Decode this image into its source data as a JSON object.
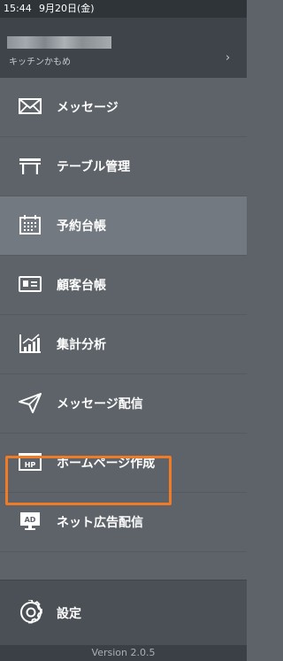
{
  "status_bar": {
    "time": "15:44",
    "date": "9月20日(金)"
  },
  "account": {
    "store_name": "キッチンかもめ",
    "chevron": "›"
  },
  "menu": [
    {
      "label": "メッセージ",
      "icon": "envelope-icon"
    },
    {
      "label": "テーブル管理",
      "icon": "table-icon"
    },
    {
      "label": "予約台帳",
      "icon": "calendar-icon",
      "selected": true
    },
    {
      "label": "顧客台帳",
      "icon": "id-card-icon"
    },
    {
      "label": "集計分析",
      "icon": "bar-chart-icon"
    },
    {
      "label": "メッセージ配信",
      "icon": "paper-plane-icon"
    },
    {
      "label": "ホームページ作成",
      "icon": "homepage-icon",
      "badge": "HP"
    },
    {
      "label": "ネット広告配信",
      "icon": "ad-monitor-icon",
      "badge": "AD"
    }
  ],
  "settings": {
    "label": "設定",
    "icon": "gear-icon"
  },
  "footer": {
    "version": "Version 2.0.5"
  },
  "colors": {
    "sidebar_bg": "#5d6369",
    "selected_bg": "#727980",
    "highlight_border": "#f07b26",
    "header_bg": "#3e444a"
  }
}
